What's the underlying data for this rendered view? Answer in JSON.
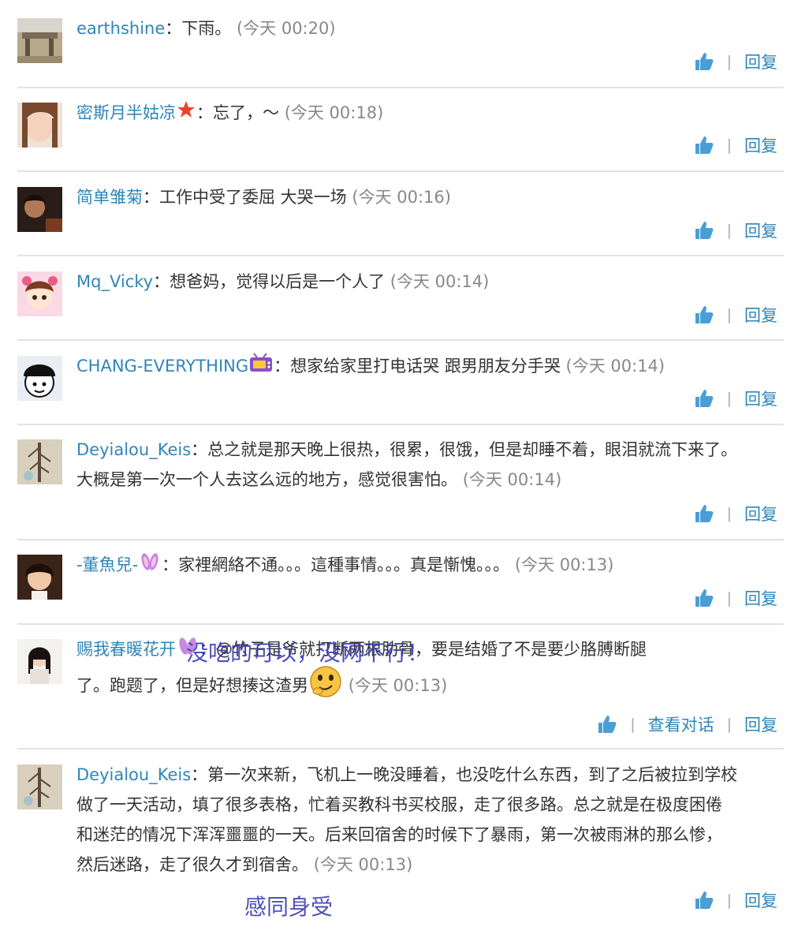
{
  "colors": {
    "username": "#2e86b8",
    "time": "#888888",
    "text": "#333333",
    "link": "#2e86b8",
    "overlay": "#3b3fb2"
  },
  "actions": {
    "reply": "回复",
    "view_conversation": "查看对话",
    "separator": "|"
  },
  "comments": [
    {
      "user": "earthshine",
      "text": "：下雨。",
      "time": "(今天 00:20)"
    },
    {
      "user": "密斯月半姑凉",
      "badge_icon": "star-badge-icon",
      "text": "：忘了，～",
      "time": "(今天 00:18)"
    },
    {
      "user": "简单雏菊",
      "text": "：工作中受了委屈 大哭一场",
      "time": "(今天 00:16)"
    },
    {
      "user": "Mq_Vicky",
      "text": "：想爸妈，觉得以后是一个人了",
      "time": "(今天 00:14)"
    },
    {
      "user": "CHANG-EVERYTHING",
      "badge_icon": "tv-badge-icon",
      "text": "：想家给家里打电话哭 跟男朋友分手哭",
      "time": "(今天 00:14)"
    },
    {
      "user": "Deyialou_Keis",
      "text": "：总之就是那天晚上很热，很累，很饿，但是却睡不着，眼泪就流下来了。",
      "text2": "大概是第一次一个人去这么远的地方，感觉很害怕。",
      "time": "(今天 00:14)"
    },
    {
      "user": "-董魚兒-",
      "badge_icon": "bunny-ears-icon",
      "text": "：家裡網絡不通。。。這種事情。。。真是慚愧。。。",
      "time": "(今天 00:13)"
    },
    {
      "user": "赐我春暖花开",
      "badge_icon": "bunny-ears-icon",
      "text": "：@竹子是爷就打断两根肋骨，要是结婚了不是要少胳膊断腿",
      "text2": "了。跑题了，但是好想揍这渣男",
      "inline_icon": "smirk-emoji-icon",
      "time": "(今天 00:13)"
    },
    {
      "user": "Deyialou_Keis",
      "text": "：第一次来新，飞机上一晚没睡着，也没吃什么东西，到了之后被拉到学校",
      "text2": "做了一天活动，填了很多表格，忙着买教科书买校服，走了很多路。总之就是在极度困倦",
      "text3": "和迷茫的情况下浑浑噩噩的一天。后来回宿舍的时候下了暴雨，第一次被雨淋的那么惨，",
      "text4": "然后迷路，走了很久才到宿舍。",
      "time": "(今天 00:13)"
    }
  ],
  "overlays": {
    "caption1": "没吃的可以，没网不行！",
    "caption2": "感同身受"
  }
}
